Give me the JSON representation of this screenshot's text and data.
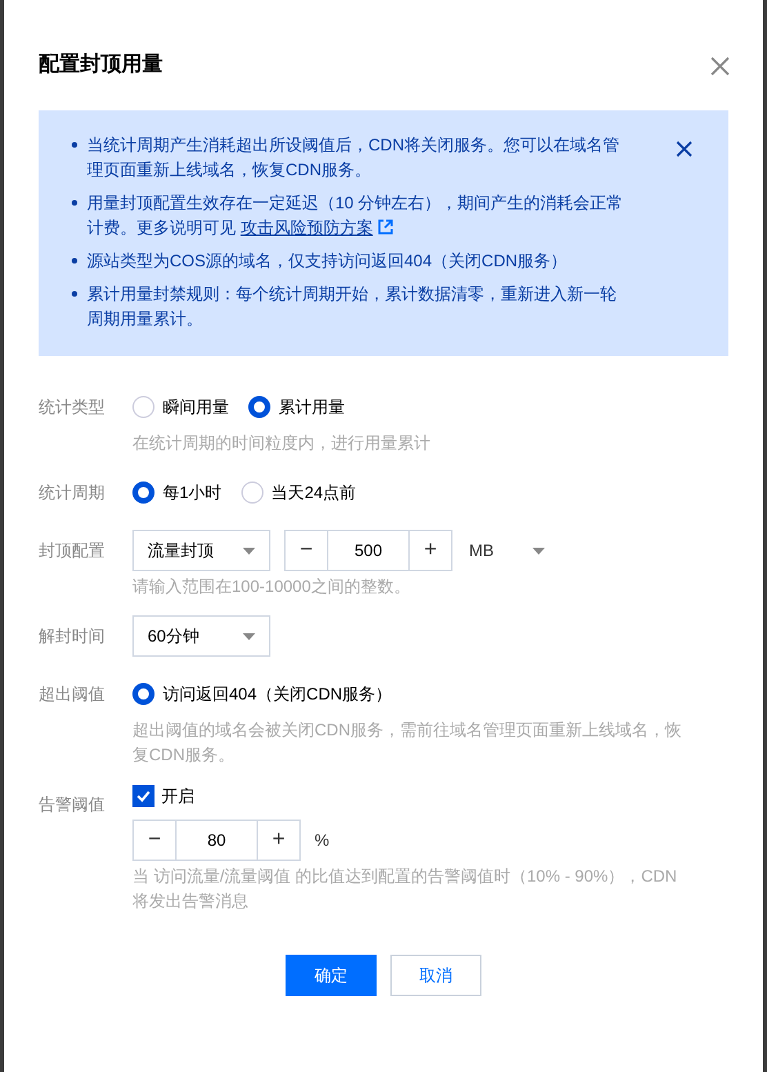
{
  "dialog": {
    "title": "配置封顶用量"
  },
  "notice": {
    "items": [
      {
        "text": "当统计周期产生消耗超出所设阈值后，CDN将关闭服务。您可以在域名管理页面重新上线域名，恢复CDN服务。"
      },
      {
        "text": "用量封顶配置生效存在一定延迟（10 分钟左右），期间产生的消耗会正常计费。更多说明可见 ",
        "link": "攻击风险预防方案"
      },
      {
        "text": "源站类型为COS源的域名，仅支持访问返回404（关闭CDN服务）"
      },
      {
        "text": "累计用量封禁规则：每个统计周期开始，累计数据清零，重新进入新一轮周期用量累计。"
      }
    ]
  },
  "form": [
    {
      "label": "统计类型",
      "controls": [
        {
          "kind": "radio",
          "label": "瞬间用量",
          "selected": false
        },
        {
          "kind": "radio",
          "label": "累计用量",
          "selected": true
        }
      ],
      "hint": "在统计周期的时间粒度内，进行用量累计"
    },
    {
      "label": "统计周期",
      "controls": [
        {
          "kind": "radio",
          "label": "每1小时",
          "selected": true
        },
        {
          "kind": "radio",
          "label": "当天24点前",
          "selected": false
        }
      ]
    },
    {
      "label": "封顶配置",
      "controls": [
        {
          "kind": "select",
          "label": "流量封顶"
        },
        {
          "kind": "stepper",
          "minus": "−",
          "value": "500",
          "plus": "+"
        },
        {
          "kind": "unit-select",
          "label": "MB"
        }
      ],
      "hint": "请输入范围在100-10000之间的整数。"
    },
    {
      "label": "解封时间",
      "controls": [
        {
          "kind": "select",
          "label": "60分钟"
        }
      ]
    },
    {
      "label": "超出阈值",
      "controls": [
        {
          "kind": "radio",
          "label": "访问返回404（关闭CDN服务）",
          "selected": true
        }
      ],
      "hint": "超出阈值的域名会被关闭CDN服务，需前往域名管理页面重新上线域名，恢复CDN服务。"
    },
    {
      "label": "告警阈值",
      "controls": [
        {
          "kind": "checkbox",
          "label": "开启",
          "checked": true
        },
        {
          "kind": "stepper",
          "minus": "−",
          "value": "80",
          "plus": "+"
        },
        {
          "kind": "unit",
          "label": "%"
        }
      ],
      "hint": "当 访问流量/流量阈值 的比值达到配置的告警阈值时（10% - 90%），CDN将发出告警消息"
    }
  ],
  "buttons": [
    {
      "label": "确定",
      "kind": "primary"
    },
    {
      "label": "取消",
      "kind": "secondary"
    }
  ]
}
